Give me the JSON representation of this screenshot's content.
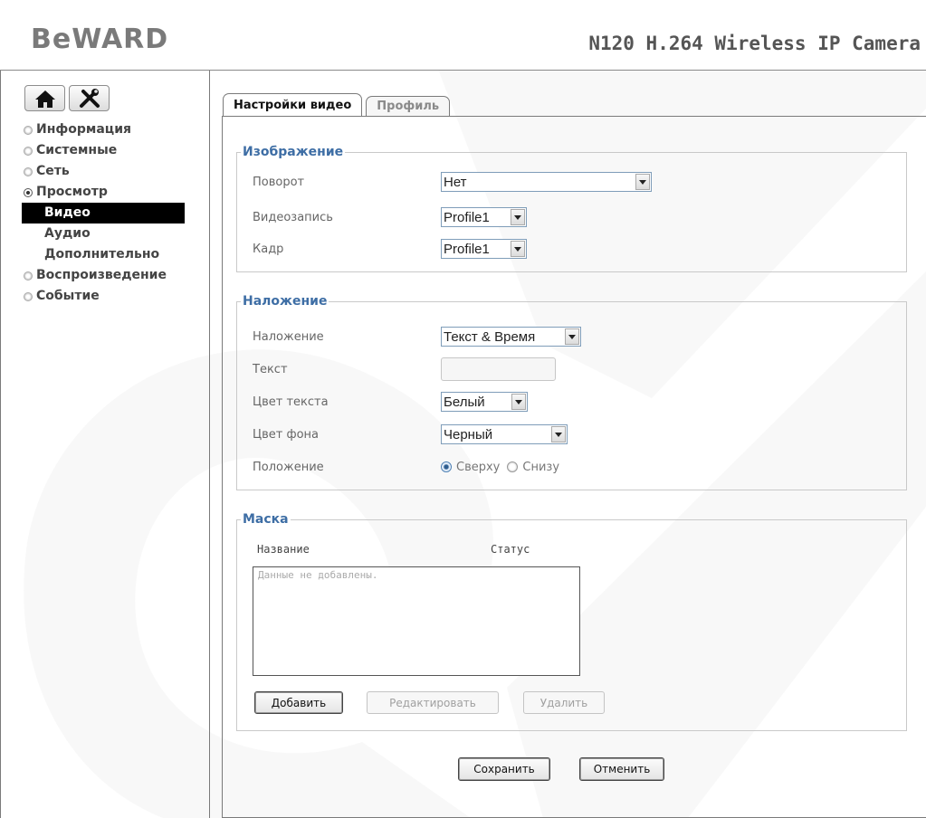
{
  "header": {
    "logo": "BeWARD",
    "product_title": "N120 H.264 Wireless IP Camera"
  },
  "sidebar": {
    "home_icon": "home-icon",
    "settings_icon": "tools-icon",
    "items": [
      {
        "label": "Информация",
        "bullet": "off"
      },
      {
        "label": "Системные",
        "bullet": "off"
      },
      {
        "label": "Сеть",
        "bullet": "off"
      },
      {
        "label": "Просмотр",
        "bullet": "on"
      }
    ],
    "subitems": [
      {
        "label": "Видео",
        "active": true
      },
      {
        "label": "Аудио",
        "active": false
      },
      {
        "label": "Дополнительно",
        "active": false
      }
    ],
    "items_after": [
      {
        "label": "Воспроизведение",
        "bullet": "off"
      },
      {
        "label": "Событие",
        "bullet": "off"
      }
    ]
  },
  "tabs": [
    {
      "label": "Настройки видео",
      "active": true
    },
    {
      "label": "Профиль",
      "active": false
    }
  ],
  "image_group": {
    "title": "Изображение",
    "rotation": {
      "label": "Поворот",
      "value": "Нет"
    },
    "recording": {
      "label": "Видеозапись",
      "value": "Profile1"
    },
    "frame": {
      "label": "Кадр",
      "value": "Profile1"
    }
  },
  "overlay_group": {
    "title": "Наложение",
    "overlay": {
      "label": "Наложение",
      "value": "Текст & Время"
    },
    "text": {
      "label": "Текст",
      "value": ""
    },
    "text_color": {
      "label": "Цвет текста",
      "value": "Белый"
    },
    "bg_color": {
      "label": "Цвет фона",
      "value": "Черный"
    },
    "position": {
      "label": "Положение",
      "option_top": "Сверху",
      "option_bottom": "Снизу",
      "selected": "top"
    }
  },
  "mask_group": {
    "title": "Маска",
    "col_name": "Название",
    "col_status": "Статус",
    "empty_text": "Данные не добавлены.",
    "add_label": "Добавить",
    "edit_label": "Редактировать",
    "delete_label": "Удалить"
  },
  "actions": {
    "save_label": "Сохранить",
    "cancel_label": "Отменить"
  },
  "colors": {
    "group_title": "#3e6ea5",
    "active_nav_bg": "#000000",
    "border": "#7a7a7a"
  }
}
